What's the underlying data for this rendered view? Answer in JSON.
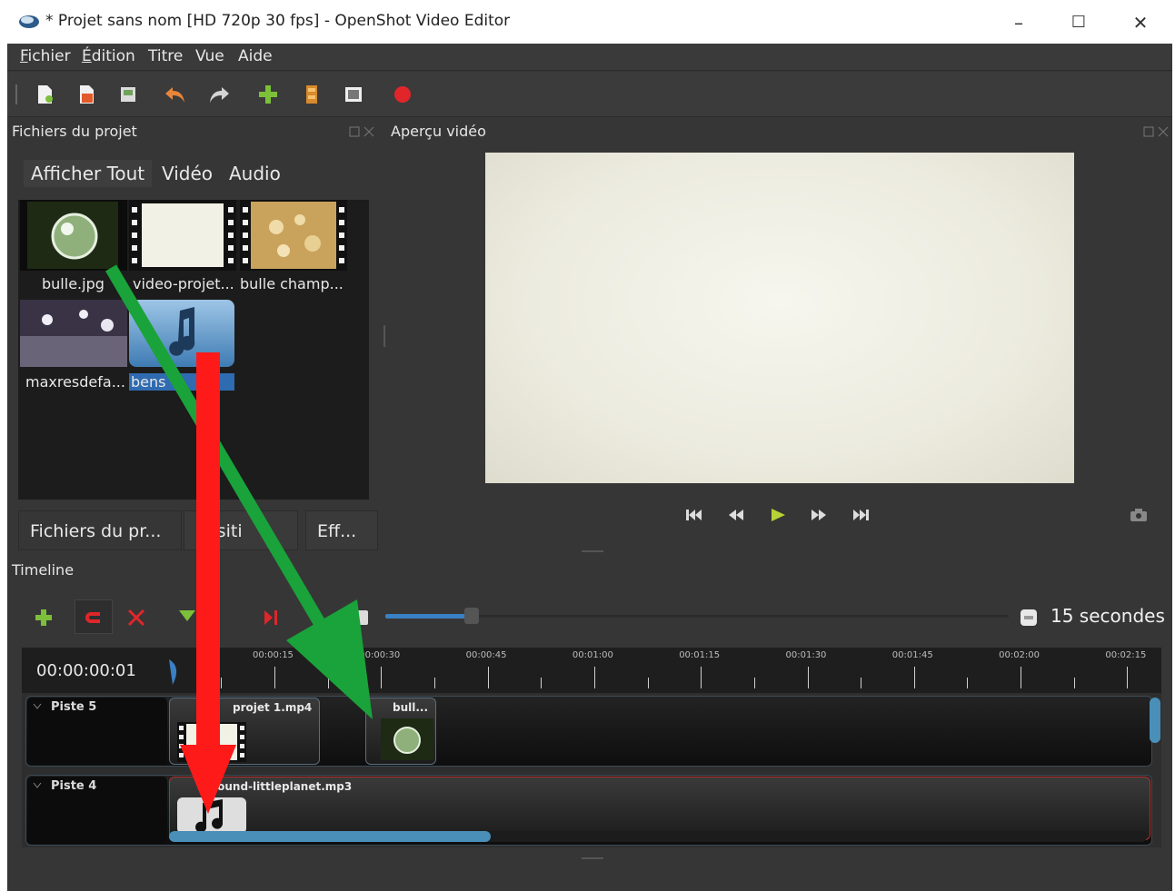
{
  "window": {
    "title": "* Projet sans nom [HD 720p 30 fps] - OpenShot Video Editor",
    "minimize": "–",
    "maximize": "☐",
    "close": "✕"
  },
  "menu": {
    "items": [
      {
        "first": "F",
        "rest": "ichier"
      },
      {
        "first": "É",
        "rest": "dition"
      },
      {
        "first": "",
        "rest": "Titre"
      },
      {
        "first": "",
        "rest": "Vue"
      },
      {
        "first": "",
        "rest": "Aide"
      }
    ]
  },
  "toolbar": {
    "icons": [
      "new-project-icon",
      "open-project-icon",
      "save-project-icon",
      "undo-icon",
      "redo-icon",
      "import-files-icon",
      "profile-icon",
      "fullscreen-icon",
      "export-video-icon"
    ]
  },
  "project_files": {
    "title": "Fichiers du projet",
    "filters": [
      "Afficher Tout",
      "Vidéo",
      "Audio"
    ],
    "files": [
      {
        "label": "bulle.jpg",
        "icon": "image-thumbnail"
      },
      {
        "label": "video-projet...",
        "icon": "video-thumbnail"
      },
      {
        "label": "bulle champ...",
        "icon": "video-thumbnail"
      },
      {
        "label": "maxresdefa...",
        "icon": "image-thumbnail"
      },
      {
        "label": "bens",
        "icon": "audio-file-icon"
      }
    ]
  },
  "bottom_tabs": [
    "Fichiers du pr...",
    "ansiti",
    "Eff..."
  ],
  "preview": {
    "title": "Aperçu vidéo",
    "controls": [
      "jump-start-icon",
      "rewind-icon",
      "play-icon",
      "fast-forward-icon",
      "jump-end-icon"
    ]
  },
  "timeline": {
    "title": "Timeline",
    "zoom_value": "15 secondes",
    "zoom_fraction": 0.14,
    "time": "00:00:00:01",
    "ticks": [
      "00:00:15",
      "00:00:30",
      "00:00:45",
      "00:01:00",
      "00:01:15",
      "00:01:30",
      "00:01:45",
      "00:02:00",
      "00:02:15"
    ],
    "tracks": [
      {
        "name": "Piste 5",
        "clips": [
          "projet 1.mp4",
          "bull..."
        ]
      },
      {
        "name": "Piste 4",
        "clips": [
          "sound-littleplanet.mp3"
        ]
      }
    ]
  },
  "colors": {
    "accent": "#3a80c4",
    "play": "#b5d334",
    "annotation_red": "#ff1a1a",
    "annotation_green": "#1aa33a"
  }
}
